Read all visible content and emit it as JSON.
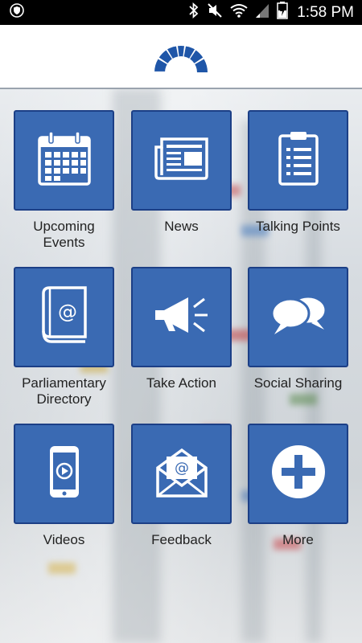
{
  "status_bar": {
    "time": "1:58 PM",
    "icons": [
      "shield-icon",
      "bluetooth-icon",
      "mute-icon",
      "wifi-icon",
      "signal-icon",
      "battery-charging-icon"
    ]
  },
  "header": {
    "logo": "fan-logo-icon"
  },
  "colors": {
    "tile_fill": "#3a6ab3",
    "tile_border": "#1c3f86",
    "logo": "#1f56a8"
  },
  "tiles": [
    {
      "label": "Upcoming\nEvents",
      "icon": "calendar-icon"
    },
    {
      "label": "News",
      "icon": "newspaper-icon"
    },
    {
      "label": "Talking Points",
      "icon": "clipboard-list-icon"
    },
    {
      "label": "Parliamentary\nDirectory",
      "icon": "address-book-icon"
    },
    {
      "label": "Take Action",
      "icon": "megaphone-icon"
    },
    {
      "label": "Social Sharing",
      "icon": "chat-bubbles-icon"
    },
    {
      "label": "Videos",
      "icon": "phone-video-icon"
    },
    {
      "label": "Feedback",
      "icon": "email-envelope-icon"
    },
    {
      "label": "More",
      "icon": "plus-circle-icon"
    }
  ]
}
